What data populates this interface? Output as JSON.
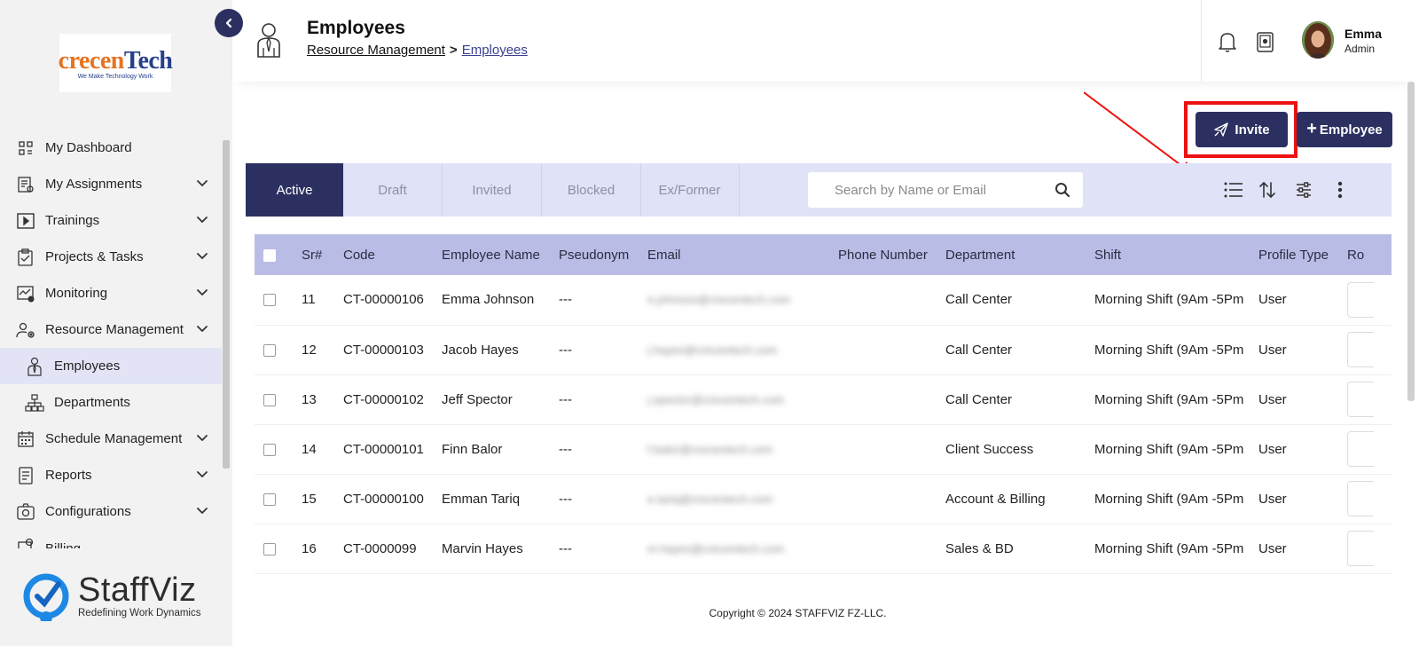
{
  "sidebar": {
    "logo": {
      "text_main": "recen",
      "text_tech": "Tech",
      "text_c": "c",
      "tagline": "We Make Technology Work"
    },
    "items": [
      {
        "label": "My Dashboard",
        "icon": "dashboard-icon",
        "has_chevron": false
      },
      {
        "label": "My Assignments",
        "icon": "assignments-icon",
        "has_chevron": true
      },
      {
        "label": "Trainings",
        "icon": "play-icon",
        "has_chevron": true
      },
      {
        "label": "Projects & Tasks",
        "icon": "clipboard-icon",
        "has_chevron": true
      },
      {
        "label": "Monitoring",
        "icon": "monitor-icon",
        "has_chevron": true
      },
      {
        "label": "Resource Management",
        "icon": "users-gear-icon",
        "has_chevron": true
      },
      {
        "label": "Employees",
        "icon": "employee-icon",
        "has_chevron": false,
        "sub": true,
        "active": true
      },
      {
        "label": "Departments",
        "icon": "org-chart-icon",
        "has_chevron": false,
        "sub": true
      },
      {
        "label": "Schedule Management",
        "icon": "calendar-icon",
        "has_chevron": true
      },
      {
        "label": "Reports",
        "icon": "report-icon",
        "has_chevron": true
      },
      {
        "label": "Configurations",
        "icon": "config-icon",
        "has_chevron": true
      },
      {
        "label": "Billing",
        "icon": "billing-icon",
        "has_chevron": false
      }
    ],
    "brand": {
      "name": "StaffViz",
      "tagline": "Redefining Work Dynamics"
    }
  },
  "header": {
    "title": "Employees",
    "breadcrumb": {
      "parent": "Resource Management",
      "separator": ">",
      "current": "Employees"
    },
    "user": {
      "name": "Emma",
      "role": "Admin"
    }
  },
  "actions": {
    "invite_label": "Invite",
    "employee_label": "Employee",
    "employee_prefix": "+"
  },
  "tabs": [
    "Active",
    "Draft",
    "Invited",
    "Blocked",
    "Ex/Former"
  ],
  "active_tab": "Active",
  "search": {
    "placeholder": "Search by Name or Email",
    "value": ""
  },
  "table": {
    "columns": [
      "Sr#",
      "Code",
      "Employee Name",
      "Pseudonym",
      "Email",
      "Phone Number",
      "Department",
      "Shift",
      "Profile Type",
      "Ro"
    ],
    "rows": [
      {
        "sr": "11",
        "code": "CT-00000106",
        "name": "Emma Johnson",
        "pseudonym": "---",
        "email": "e.johnson@crecentech.com",
        "phone": "",
        "department": "Call Center",
        "shift": "Morning Shift (9Am -5Pm",
        "profile": "User"
      },
      {
        "sr": "12",
        "code": "CT-00000103",
        "name": "Jacob Hayes",
        "pseudonym": "---",
        "email": "j.hayes@crecentech.com",
        "phone": "",
        "department": "Call Center",
        "shift": "Morning Shift (9Am -5Pm",
        "profile": "User"
      },
      {
        "sr": "13",
        "code": "CT-00000102",
        "name": "Jeff Spector",
        "pseudonym": "---",
        "email": "j.spector@crecentech.com",
        "phone": "",
        "department": "Call Center",
        "shift": "Morning Shift (9Am -5Pm",
        "profile": "User"
      },
      {
        "sr": "14",
        "code": "CT-00000101",
        "name": "Finn Balor",
        "pseudonym": "---",
        "email": "f.balor@crecentech.com",
        "phone": "",
        "department": "Client Success",
        "shift": "Morning Shift (9Am -5Pm",
        "profile": "User"
      },
      {
        "sr": "15",
        "code": "CT-00000100",
        "name": "Emman Tariq",
        "pseudonym": "---",
        "email": "e.tariq@crecentech.com",
        "phone": "",
        "department": "Account & Billing",
        "shift": "Morning Shift (9Am -5Pm",
        "profile": "User"
      },
      {
        "sr": "16",
        "code": "CT-0000099",
        "name": "Marvin Hayes",
        "pseudonym": "---",
        "email": "m.hayes@crecentech.com",
        "phone": "",
        "department": "Sales & BD",
        "shift": "Morning Shift (9Am -5Pm",
        "profile": "User"
      }
    ]
  },
  "footer": {
    "copyright": "Copyright © 2024 STAFFVIZ FZ-LLC."
  },
  "colors": {
    "primary": "#2c3061",
    "toolbar_bg": "#e0e2f7",
    "table_header_bg": "#b9bde6",
    "highlight": "#ee1111",
    "sidebar_bg": "#f2f2f2"
  }
}
